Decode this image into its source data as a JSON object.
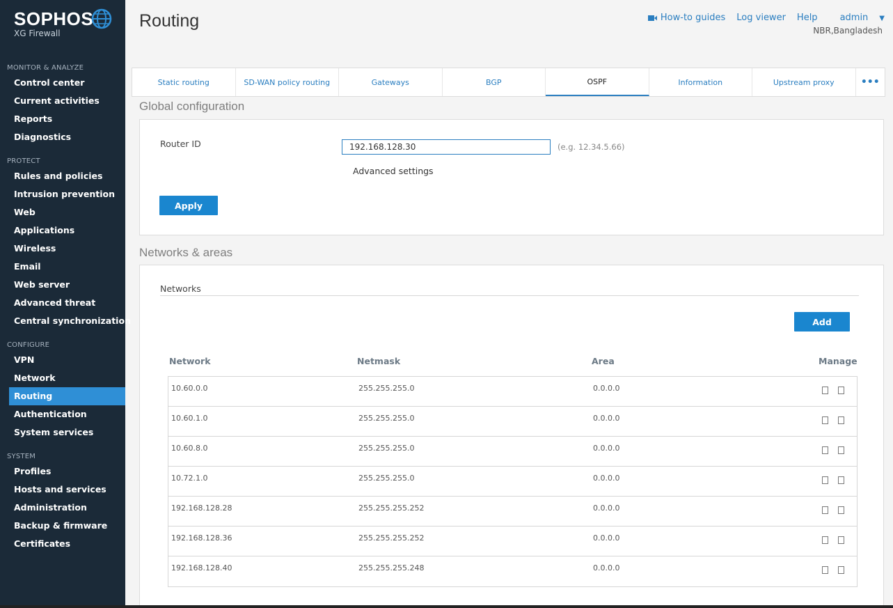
{
  "brand": {
    "name": "SOPHOS",
    "product": "XG Firewall"
  },
  "nav": {
    "sections": [
      {
        "label": "MONITOR & ANALYZE",
        "items": [
          "Control center",
          "Current activities",
          "Reports",
          "Diagnostics"
        ]
      },
      {
        "label": "PROTECT",
        "items": [
          "Rules and policies",
          "Intrusion prevention",
          "Web",
          "Applications",
          "Wireless",
          "Email",
          "Web server",
          "Advanced threat",
          "Central synchronization"
        ]
      },
      {
        "label": "CONFIGURE",
        "items": [
          "VPN",
          "Network",
          "Routing",
          "Authentication",
          "System services"
        ]
      },
      {
        "label": "SYSTEM",
        "items": [
          "Profiles",
          "Hosts and services",
          "Administration",
          "Backup & firmware",
          "Certificates"
        ]
      }
    ],
    "active": "Routing"
  },
  "header": {
    "title": "Routing",
    "howto": "How-to guides",
    "logviewer": "Log viewer",
    "help": "Help",
    "user": "admin",
    "location": "NBR,Bangladesh"
  },
  "tabs": [
    "Static routing",
    "SD-WAN policy routing",
    "Gateways",
    "BGP",
    "OSPF",
    "Information",
    "Upstream proxy"
  ],
  "active_tab": "OSPF",
  "tabs_more": "•••",
  "global": {
    "title": "Global configuration",
    "router_label": "Router ID",
    "router_value": "192.168.128.30",
    "router_hint": "(e.g. 12.34.5.66)",
    "advanced": "Advanced settings",
    "apply": "Apply"
  },
  "networks": {
    "title": "Networks & areas",
    "subtitle": "Networks",
    "add": "Add",
    "columns": {
      "network": "Network",
      "netmask": "Netmask",
      "area": "Area",
      "manage": "Manage"
    },
    "rows": [
      {
        "network": "10.60.0.0",
        "netmask": "255.255.255.0",
        "area": "0.0.0.0"
      },
      {
        "network": "10.60.1.0",
        "netmask": "255.255.255.0",
        "area": "0.0.0.0"
      },
      {
        "network": "10.60.8.0",
        "netmask": "255.255.255.0",
        "area": "0.0.0.0"
      },
      {
        "network": "10.72.1.0",
        "netmask": "255.255.255.0",
        "area": "0.0.0.0"
      },
      {
        "network": "192.168.128.28",
        "netmask": "255.255.255.252",
        "area": "0.0.0.0"
      },
      {
        "network": "192.168.128.36",
        "netmask": "255.255.255.252",
        "area": "0.0.0.0"
      },
      {
        "network": "192.168.128.40",
        "netmask": "255.255.255.248",
        "area": "0.0.0.0"
      }
    ]
  },
  "colors": {
    "sidebar": "#1b2a38",
    "accent": "#1a86cf",
    "active_nav": "#2f8fd6"
  },
  "icons": {
    "brand": "globe-icon",
    "howto": "video-camera-icon",
    "user_menu": "chevron-down-icon",
    "edit": "edit-icon",
    "delete": "delete-icon"
  }
}
